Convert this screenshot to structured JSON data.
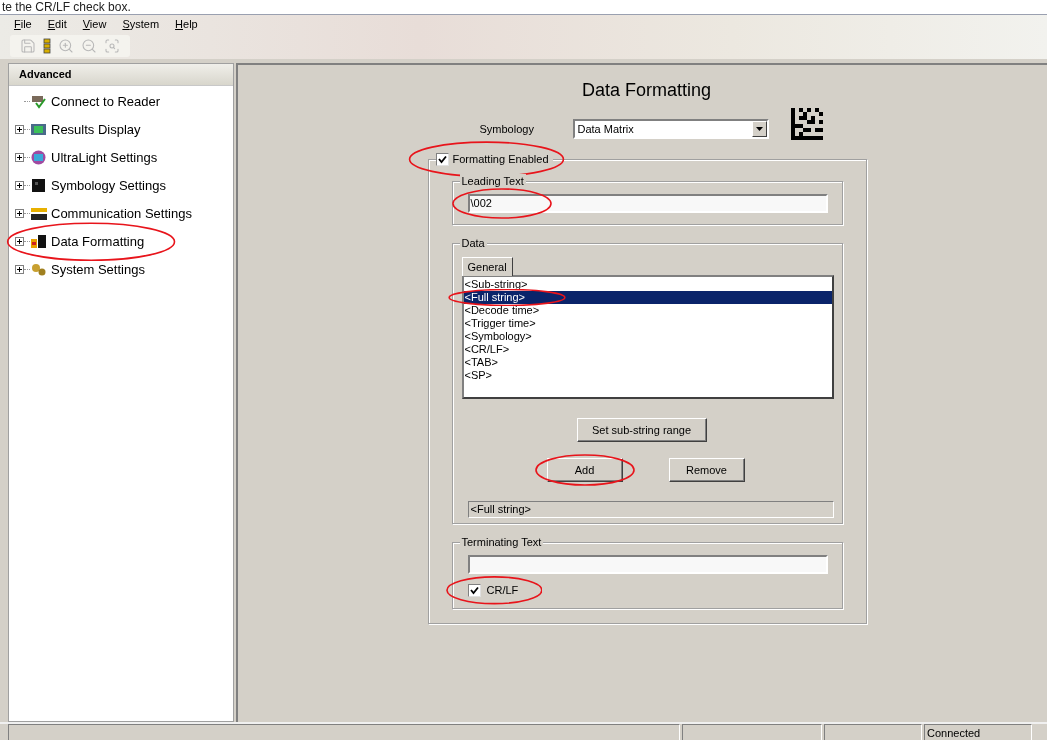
{
  "caption": "te the CR/LF check box.",
  "menu": [
    "File",
    "Edit",
    "View",
    "System",
    "Help"
  ],
  "toolbar": [
    {
      "kind": "save",
      "disabled": true
    },
    {
      "kind": "connect",
      "disabled": false
    },
    {
      "kind": "zoom_in",
      "disabled": true
    },
    {
      "kind": "zoom_out",
      "disabled": true
    },
    {
      "kind": "zoom_fit",
      "disabled": true
    }
  ],
  "sidebar": {
    "header": "Advanced",
    "items": [
      {
        "label": "Connect to Reader",
        "kind": "reader",
        "expandable": false,
        "circled": false
      },
      {
        "label": "Results Display",
        "kind": "display",
        "expandable": true,
        "circled": false
      },
      {
        "label": "UltraLight Settings",
        "kind": "light",
        "expandable": true,
        "circled": false
      },
      {
        "label": "Symbology Settings",
        "kind": "symbology",
        "expandable": true,
        "circled": false
      },
      {
        "label": "Communication Settings",
        "kind": "communication",
        "expandable": true,
        "circled": false
      },
      {
        "label": "Data Formatting",
        "kind": "formatting",
        "expandable": true,
        "circled": true
      },
      {
        "label": "System Settings",
        "kind": "gears",
        "expandable": true,
        "circled": false
      }
    ]
  },
  "page": {
    "title": "Data Formatting",
    "symbology": {
      "label": "Symbology",
      "value": "Data Matrix"
    },
    "formatting_enabled": {
      "label": "Formatting Enabled",
      "checked": true,
      "circled": true
    },
    "leading_text": {
      "legend": "Leading Text",
      "value": "\\002",
      "circled": true
    },
    "data": {
      "legend": "Data",
      "tabs": [
        {
          "label": "General",
          "selected": true
        }
      ],
      "list": [
        {
          "label": "<Sub-string>",
          "selected": false,
          "circled": false
        },
        {
          "label": "<Full string>",
          "selected": true,
          "circled": true
        },
        {
          "label": "<Decode time>",
          "selected": false,
          "circled": false
        },
        {
          "label": "<Trigger time>",
          "selected": false,
          "circled": false
        },
        {
          "label": "<Symbology>",
          "selected": false,
          "circled": false
        },
        {
          "label": "<CR/LF>",
          "selected": false,
          "circled": false
        },
        {
          "label": "<TAB>",
          "selected": false,
          "circled": false
        },
        {
          "label": "<SP>",
          "selected": false,
          "circled": false
        }
      ],
      "buttons": [
        {
          "label": "Set sub-string range",
          "circled": false
        },
        {
          "label": "Add",
          "circled": true
        },
        {
          "label": "Remove",
          "circled": false
        }
      ],
      "output": "<Full string>"
    },
    "terminating_text": {
      "legend": "Terminating Text",
      "crlf": {
        "label": "CR/LF",
        "checked": true,
        "circled": true
      }
    }
  },
  "status_bar": {
    "connection": "Connected"
  }
}
